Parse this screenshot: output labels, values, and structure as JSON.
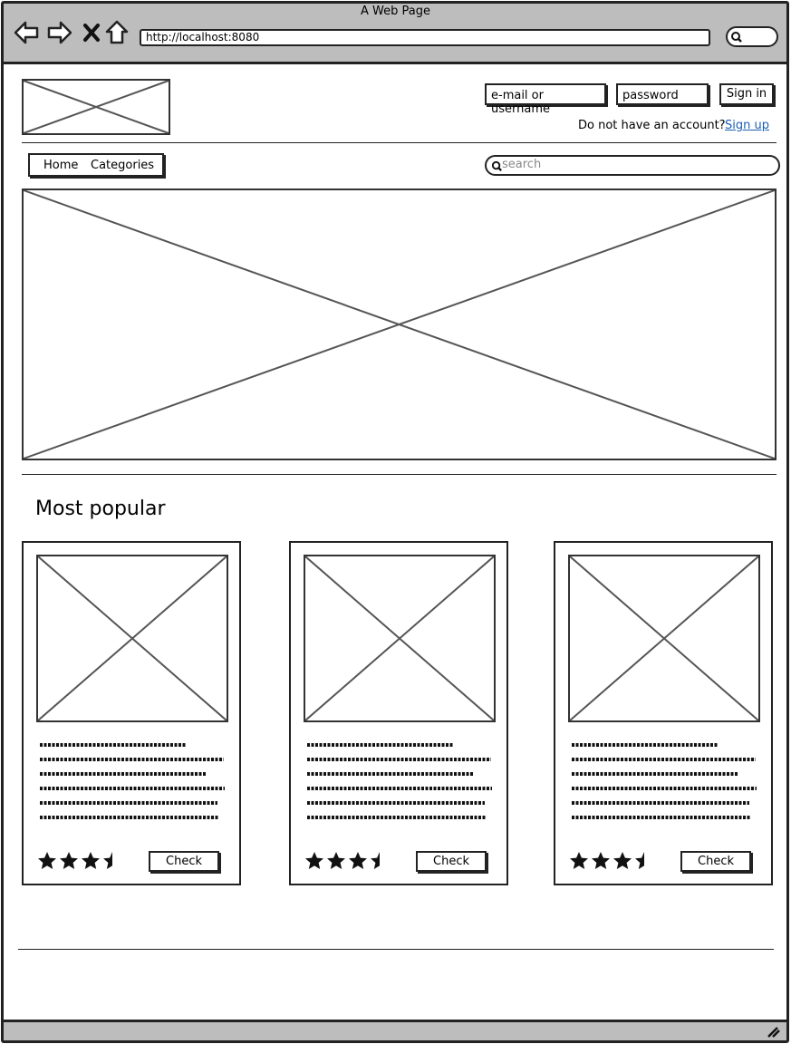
{
  "browser": {
    "window_title": "A Web Page",
    "url": "http://localhost:8080"
  },
  "header": {
    "login_placeholder": "e-mail or username",
    "password_placeholder": "password",
    "signin_label": "Sign in",
    "no_account_text": "Do not have an account?",
    "signup_label": "Sign up"
  },
  "nav": {
    "items": [
      {
        "label": "Home"
      },
      {
        "label": "Categories"
      }
    ],
    "search_placeholder": "search"
  },
  "main": {
    "section_title": "Most popular",
    "cards": [
      {
        "rating": 3.5,
        "button_label": "Check"
      },
      {
        "rating": 3.5,
        "button_label": "Check"
      },
      {
        "rating": 3.5,
        "button_label": "Check"
      }
    ]
  },
  "colors": {
    "chrome": "#bdbdbd",
    "link": "#1a5fb4",
    "outline": "#222222"
  }
}
